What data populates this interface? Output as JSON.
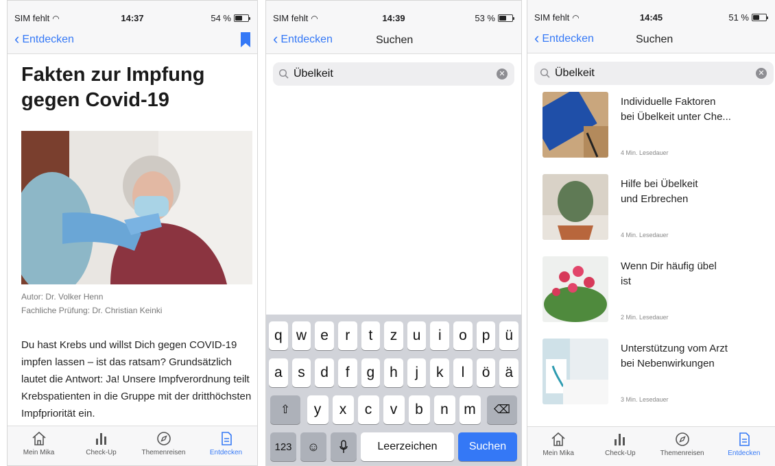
{
  "screens": [
    {
      "status": {
        "carrier": "SIM fehlt",
        "time": "14:37",
        "battery": "54 %",
        "battery_level": 0.54
      },
      "nav": {
        "back_label": "Entdecken"
      },
      "article": {
        "title": "Fakten zur Impfung gegen Covid-19",
        "author": "Autor: Dr. Volker Henn",
        "review": "Fachliche Prüfung: Dr. Christian Keinki",
        "body": "Du hast Krebs und willst Dich gegen COVID-19 impfen lassen – ist das ratsam? Grundsätzlich lautet die Antwort: Ja! Unsere Impfverordnung teilt Krebspatienten in die Gruppe mit der dritthöchsten Impfpriorität ein."
      }
    },
    {
      "status": {
        "carrier": "SIM fehlt",
        "time": "14:39",
        "battery": "53 %",
        "battery_level": 0.53
      },
      "nav": {
        "back_label": "Entdecken",
        "title": "Suchen"
      },
      "search": {
        "query": "Übelkeit"
      },
      "keyboard": {
        "row1": [
          "q",
          "w",
          "e",
          "r",
          "t",
          "z",
          "u",
          "i",
          "o",
          "p",
          "ü"
        ],
        "row2": [
          "a",
          "s",
          "d",
          "f",
          "g",
          "h",
          "j",
          "k",
          "l",
          "ö",
          "ä"
        ],
        "row3": [
          "y",
          "x",
          "c",
          "v",
          "b",
          "n",
          "m"
        ],
        "numbers_label": "123",
        "space_label": "Leerzeichen",
        "action_label": "Suchen"
      }
    },
    {
      "status": {
        "carrier": "SIM fehlt",
        "time": "14:45",
        "battery": "51 %",
        "battery_level": 0.51
      },
      "nav": {
        "back_label": "Entdecken",
        "title": "Suchen"
      },
      "search": {
        "query": "Übelkeit"
      },
      "results": [
        {
          "title": "Individuelle Faktoren\n bei Übelkeit unter Che...",
          "meta": "4 Min. Lesedauer"
        },
        {
          "title": "Hilfe bei Übelkeit\n und Erbrechen",
          "meta": "4 Min. Lesedauer"
        },
        {
          "title": "Wenn Dir häufig übel\n ist",
          "meta": "2 Min. Lesedauer"
        },
        {
          "title": "Unterstützung vom Arzt\nbei Nebenwirkungen",
          "meta": "3 Min. Lesedauer"
        }
      ]
    }
  ],
  "tabbar": {
    "tabs": [
      {
        "label": "Mein Mika",
        "icon": "home-icon"
      },
      {
        "label": "Check-Up",
        "icon": "bar-chart-icon"
      },
      {
        "label": "Themenreisen",
        "icon": "compass-icon"
      },
      {
        "label": "Entdecken",
        "icon": "document-icon",
        "active": true
      }
    ]
  },
  "colors": {
    "accent": "#3478f6",
    "keyboard_bg": "#d1d3d9"
  }
}
